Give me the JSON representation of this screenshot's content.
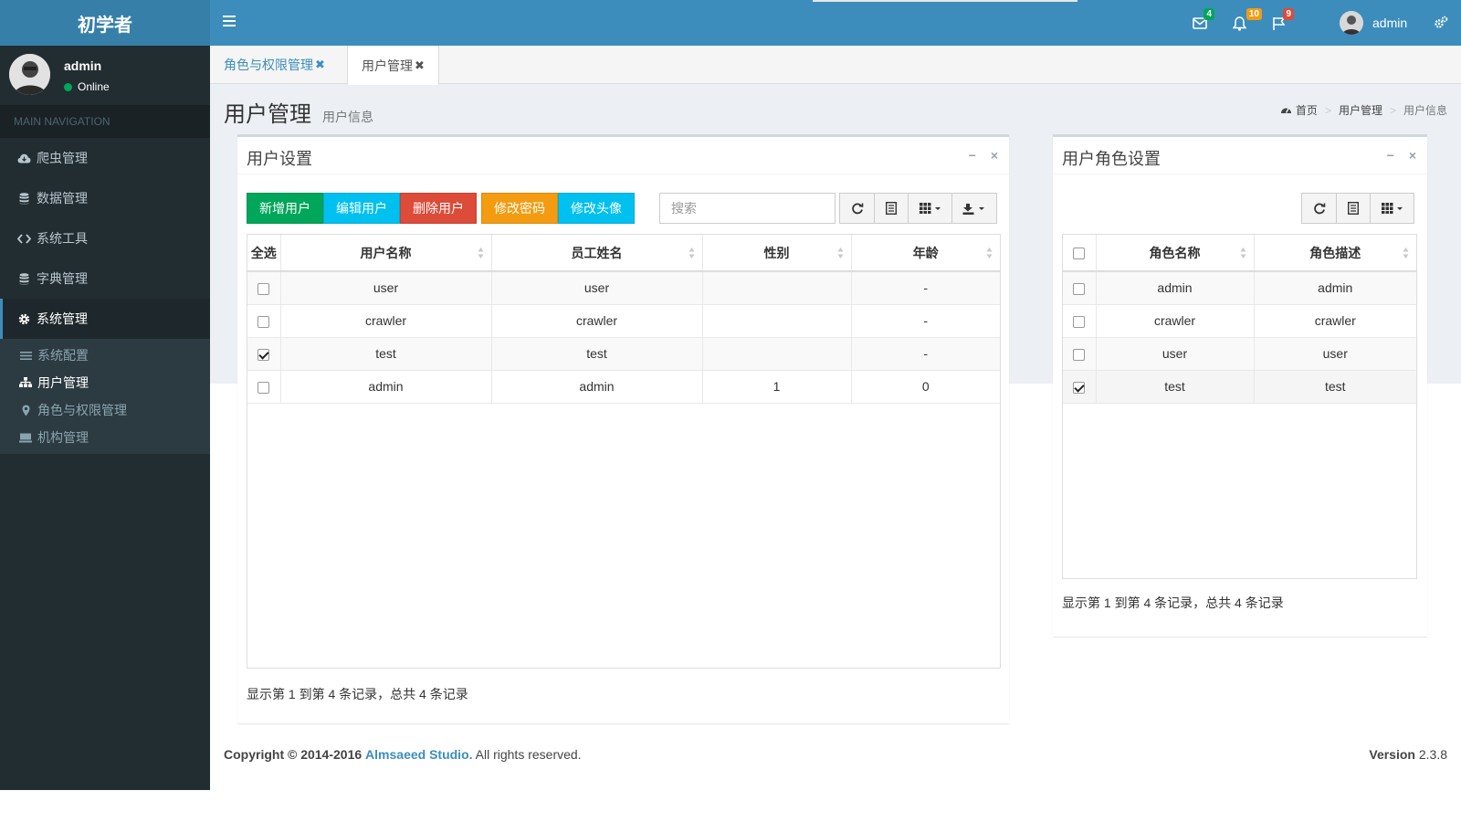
{
  "app": {
    "logo": "初学者"
  },
  "topnav": {
    "mail_count": "4",
    "bell_count": "10",
    "flag_count": "9",
    "user_name": "admin",
    "colors": {
      "header": "#3c8dbc",
      "logo_bg": "#367fa9",
      "sidebar": "#222d32"
    }
  },
  "sidebar": {
    "user_name": "admin",
    "status": "Online",
    "header": "MAIN NAVIGATION",
    "items": [
      {
        "label": "爬虫管理",
        "icon": "cloud-icon"
      },
      {
        "label": "数据管理",
        "icon": "database-icon"
      },
      {
        "label": "系统工具",
        "icon": "code-icon"
      },
      {
        "label": "字典管理",
        "icon": "database-icon"
      },
      {
        "label": "系统管理",
        "icon": "gear-icon"
      }
    ],
    "subitems": [
      {
        "label": "系统配置",
        "icon": "list-icon"
      },
      {
        "label": "用户管理",
        "icon": "sitemap-icon"
      },
      {
        "label": "角色与权限管理",
        "icon": "map-marker-icon"
      },
      {
        "label": "机构管理",
        "icon": "keyboard-icon"
      }
    ]
  },
  "tabs": [
    {
      "label": "角色与权限管理"
    },
    {
      "label": "用户管理"
    }
  ],
  "page": {
    "title": "用户管理",
    "subtitle": "用户信息",
    "breadcrumb": [
      "首页",
      "用户管理",
      "用户信息"
    ]
  },
  "user_box": {
    "title": "用户设置",
    "buttons": [
      "新增用户",
      "编辑用户",
      "删除用户",
      "修改密码",
      "修改头像"
    ],
    "search_placeholder": "搜索",
    "columns": [
      "全选",
      "用户名称",
      "员工姓名",
      "性别",
      "年龄"
    ],
    "rows": [
      {
        "checked": false,
        "username": "user",
        "name": "user",
        "gender": "",
        "age": "-"
      },
      {
        "checked": false,
        "username": "crawler",
        "name": "crawler",
        "gender": "",
        "age": "-"
      },
      {
        "checked": true,
        "username": "test",
        "name": "test",
        "gender": "",
        "age": "-"
      },
      {
        "checked": false,
        "username": "admin",
        "name": "admin",
        "gender": "1",
        "age": "0"
      }
    ],
    "pagination": "显示第 1 到第 4 条记录，总共 4 条记录"
  },
  "role_box": {
    "title": "用户角色设置",
    "columns": [
      "角色名称",
      "角色描述"
    ],
    "rows": [
      {
        "checked": false,
        "name": "admin",
        "desc": "admin"
      },
      {
        "checked": false,
        "name": "crawler",
        "desc": "crawler"
      },
      {
        "checked": false,
        "name": "user",
        "desc": "user"
      },
      {
        "checked": true,
        "name": "test",
        "desc": "test"
      }
    ],
    "pagination": "显示第 1 到第 4 条记录，总共 4 条记录"
  },
  "footer": {
    "copyright": "Copyright © 2014-2016",
    "studio": "Almsaeed Studio.",
    "rights": "All rights reserved.",
    "version_label": "Version",
    "version": "2.3.8"
  }
}
